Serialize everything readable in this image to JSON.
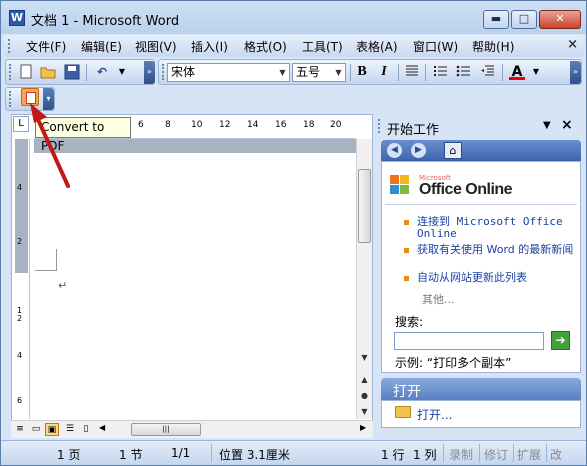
{
  "window": {
    "title": "文档 1 - Microsoft Word",
    "app_icon": "W"
  },
  "controls": {
    "minimize": "▬",
    "maximize": "□",
    "close": "✕"
  },
  "menubar": {
    "items": [
      "文件(F)",
      "编辑(E)",
      "视图(V)",
      "插入(I)",
      "格式(O)",
      "工具(T)",
      "表格(A)",
      "窗口(W)",
      "帮助(H)"
    ],
    "close": "×"
  },
  "toolbar": {
    "font_name": "宋体",
    "font_size": "五号",
    "bold": "B",
    "italic": "I",
    "font_color_label": "A"
  },
  "pdf_toolbar": {
    "tooltip": "Convert to PDF"
  },
  "ruler": {
    "ticks": [
      "6",
      "8",
      "10",
      "12",
      "14",
      "16",
      "18",
      "20"
    ],
    "vticks": [
      "4",
      "2",
      "1",
      "2",
      "4",
      "6"
    ]
  },
  "taskpane": {
    "title": "开始工作",
    "logo_small": "Microsoft",
    "logo_big": "Office Online",
    "links": [
      "连接到 Microsoft Office Online",
      "获取有关使用 Word 的最新新闻",
      "自动从网站更新此列表"
    ],
    "more": "其他...",
    "search_label": "搜索:",
    "example": "示例: “打印多个副本”",
    "open_title": "打开",
    "open_link": "打开..."
  },
  "statusbar": {
    "page": "1 页",
    "section": "1 节",
    "page_of": "1/1",
    "position": "位置 3.1厘米",
    "line": "1 行",
    "col": "1 列",
    "rec": "录制",
    "rev": "修订",
    "ext": "扩展",
    "ovr": "改"
  }
}
